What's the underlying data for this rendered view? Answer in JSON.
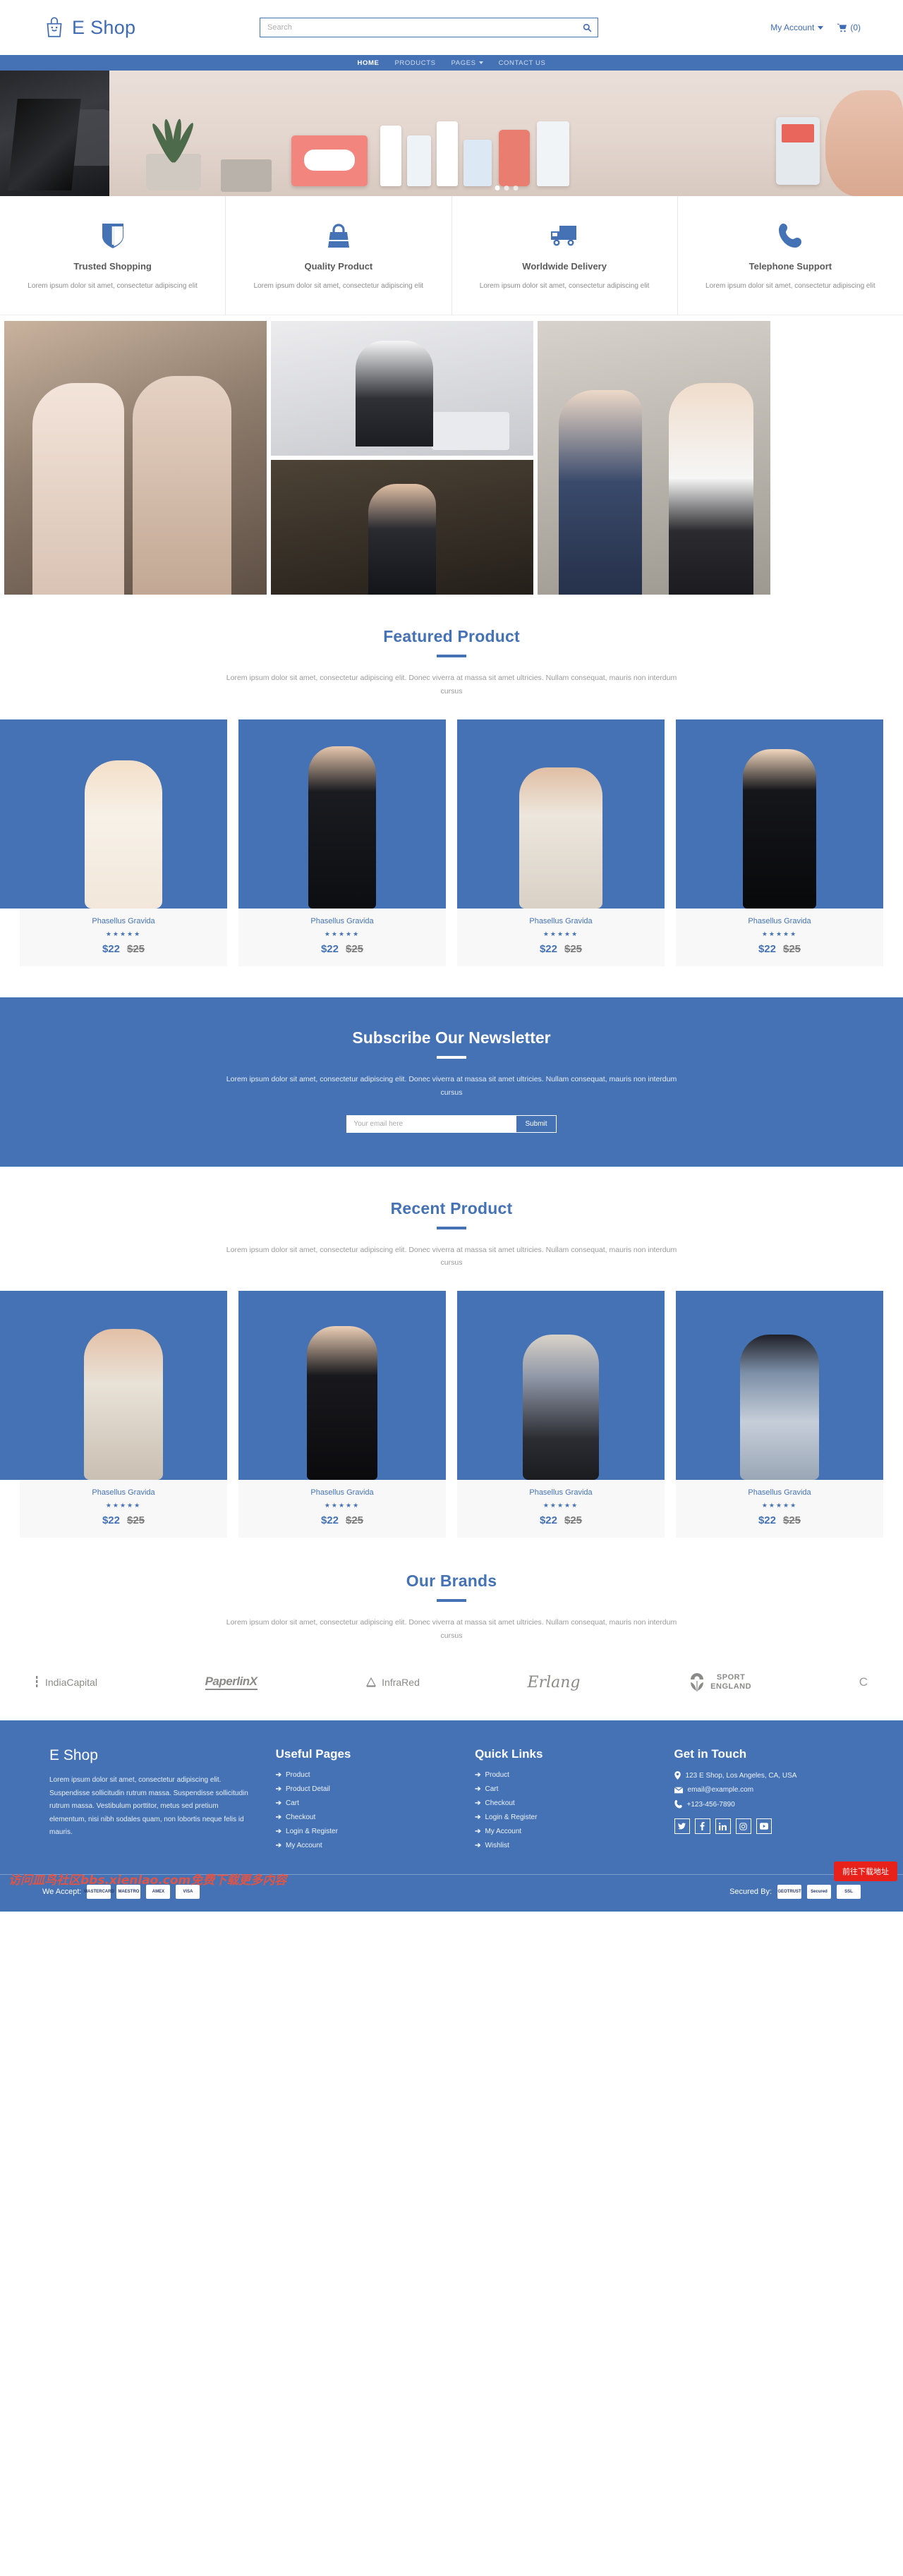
{
  "header": {
    "brand": "E Shop",
    "brand_icon": "shopping-bag-icon",
    "search_placeholder": "Search",
    "search_value": "",
    "account_label": "My Account",
    "cart_count": "(0)"
  },
  "nav": {
    "items": [
      {
        "label": "HOME",
        "active": true,
        "has_caret": false
      },
      {
        "label": "PRODUCTS",
        "active": false,
        "has_caret": false
      },
      {
        "label": "PAGES",
        "active": false,
        "has_caret": true
      },
      {
        "label": "CONTACT US",
        "active": false,
        "has_caret": false
      }
    ]
  },
  "features": [
    {
      "icon": "shield-icon",
      "title": "Trusted Shopping",
      "text": "Lorem ipsum dolor sit amet, consectetur adipiscing elit"
    },
    {
      "icon": "handbag-icon",
      "title": "Quality Product",
      "text": "Lorem ipsum dolor sit amet, consectetur adipiscing elit"
    },
    {
      "icon": "truck-icon",
      "title": "Worldwide Delivery",
      "text": "Lorem ipsum dolor sit amet, consectetur adipiscing elit"
    },
    {
      "icon": "phone-icon",
      "title": "Telephone Support",
      "text": "Lorem ipsum dolor sit amet, consectetur adipiscing elit"
    }
  ],
  "featured": {
    "title": "Featured Product",
    "subtitle": "Lorem ipsum dolor sit amet, consectetur adipiscing elit. Donec viverra at massa sit amet ultricies. Nullam consequat, mauris non interdum cursus",
    "products": [
      {
        "name": "Phasellus Gravida",
        "stars": "★★★★★",
        "price": "$22",
        "old_price": "$25"
      },
      {
        "name": "Phasellus Gravida",
        "stars": "★★★★★",
        "price": "$22",
        "old_price": "$25"
      },
      {
        "name": "Phasellus Gravida",
        "stars": "★★★★★",
        "price": "$22",
        "old_price": "$25"
      },
      {
        "name": "Phasellus Gravida",
        "stars": "★★★★★",
        "price": "$22",
        "old_price": "$25"
      }
    ]
  },
  "newsletter": {
    "title": "Subscribe Our Newsletter",
    "text": "Lorem ipsum dolor sit amet, consectetur adipiscing elit. Donec viverra at massa sit amet ultricies. Nullam consequat, mauris non interdum cursus",
    "placeholder": "Your email here",
    "value": "",
    "submit": "Submit"
  },
  "recent": {
    "title": "Recent Product",
    "subtitle": "Lorem ipsum dolor sit amet, consectetur adipiscing elit. Donec viverra at massa sit amet ultricies. Nullam consequat, mauris non interdum cursus",
    "products": [
      {
        "name": "Phasellus Gravida",
        "stars": "★★★★★",
        "price": "$22",
        "old_price": "$25"
      },
      {
        "name": "Phasellus Gravida",
        "stars": "★★★★★",
        "price": "$22",
        "old_price": "$25"
      },
      {
        "name": "Phasellus Gravida",
        "stars": "★★★★★",
        "price": "$22",
        "old_price": "$25"
      },
      {
        "name": "Phasellus Gravida",
        "stars": "★★★★★",
        "price": "$22",
        "old_price": "$25"
      }
    ]
  },
  "brands": {
    "title": "Our Brands",
    "subtitle": "Lorem ipsum dolor sit amet, consectetur adipiscing elit. Donec viverra at massa sit amet ultricies. Nullam consequat, mauris non interdum cursus",
    "logos": [
      {
        "name": "IndiaCapital"
      },
      {
        "name": "PaperlinX"
      },
      {
        "name": "InfraRed"
      },
      {
        "name": "Erlang"
      },
      {
        "name": "SPORT ENGLAND",
        "line1": "SPORT",
        "line2": "ENGLAND"
      },
      {
        "name": "C"
      }
    ]
  },
  "footer": {
    "brand": "E Shop",
    "about": "Lorem ipsum dolor sit amet, consectetur adipiscing elit. Suspendisse sollicitudin rutrum massa. Suspendisse sollicitudin rutrum massa. Vestibulum porttitor, metus sed pretium elementum, nisi nibh sodales quam, non lobortis neque felis id mauris.",
    "useful_title": "Useful Pages",
    "useful": [
      "Product",
      "Product Detail",
      "Cart",
      "Checkout",
      "Login & Register",
      "My Account"
    ],
    "quick_title": "Quick Links",
    "quick": [
      "Product",
      "Cart",
      "Checkout",
      "Login & Register",
      "My Account",
      "Wishlist"
    ],
    "touch_title": "Get in Touch",
    "address": "123 E Shop, Los Angeles, CA, USA",
    "email": "email@example.com",
    "phone": "+123-456-7890",
    "socials": [
      "twitter-icon",
      "facebook-icon",
      "linkedin-icon",
      "instagram-icon",
      "youtube-icon"
    ],
    "accept_label": "We Accept:",
    "secured_label": "Secured By:",
    "pay_cards": [
      "MASTERCARD",
      "MAESTRO",
      "AMEX",
      "VISA"
    ],
    "secure_badges": [
      "GEOTRUST",
      "Secured",
      "SSL"
    ]
  },
  "overlay": {
    "watermark": "访问皿鸟社区bbs.xienlao.com免费下载更多内容",
    "download_button": "前往下载地址"
  },
  "colors": {
    "accent": "#4472b5",
    "text_dark": "#5a5a5a",
    "text_muted": "#9a9a9a",
    "alert": "#e8211b"
  }
}
